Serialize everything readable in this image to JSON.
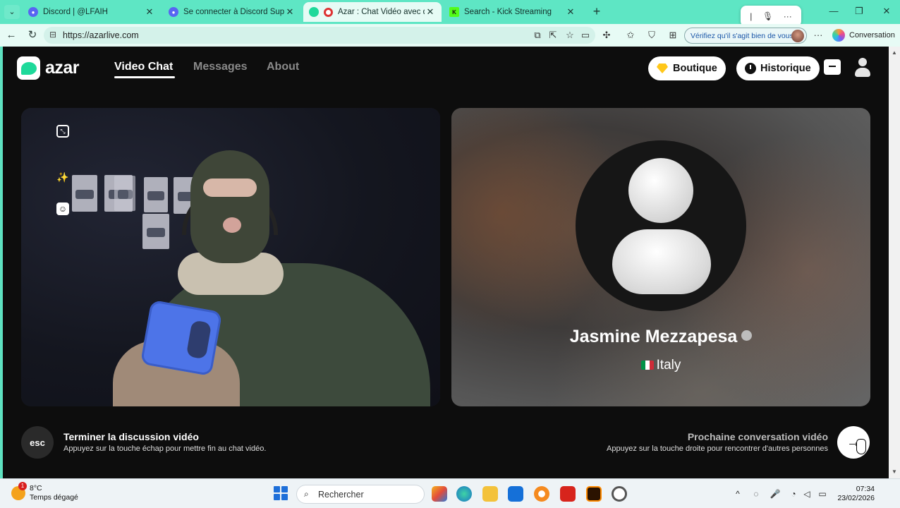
{
  "browser": {
    "tabs": [
      {
        "title": "Discord | @LFAIH",
        "icon": "discord-icon",
        "color": "#5865f2"
      },
      {
        "title": "Se connecter à Discord Support",
        "icon": "discord-icon",
        "color": "#5865f2"
      },
      {
        "title": "Azar : Chat Vidéo avec de nou",
        "icon": "azar-icon",
        "color": "#1ed99a"
      },
      {
        "title": "Search - Kick Streaming",
        "icon": "kick-icon",
        "color": "#53fc18"
      }
    ],
    "url": "https://azarlive.com",
    "verify_text": "Vérifiez qu'il s'agit bien de vous",
    "conversation_label": "Conversation"
  },
  "site": {
    "logo_text": "azar",
    "nav": [
      {
        "label": "Video Chat"
      },
      {
        "label": "Messages"
      },
      {
        "label": "About"
      }
    ],
    "boutique_label": "Boutique",
    "historique_label": "Historique"
  },
  "partner": {
    "name": "Jasmine Mezzapesa",
    "country": "Italy"
  },
  "controls": {
    "esc_label": "esc",
    "end_title": "Terminer la discussion vidéo",
    "end_subtitle": "Appuyez sur la touche échap pour mettre fin au chat vidéo.",
    "next_title": "Prochaine conversation vidéo",
    "next_subtitle": "Appuyez sur la touche droite pour rencontrer d'autres personnes"
  },
  "taskbar": {
    "weather_badge": "1",
    "temperature": "8°C",
    "weather_desc": "Temps dégagé",
    "search_placeholder": "Rechercher",
    "time": "07:34",
    "date": "23/02/2026"
  },
  "colors": {
    "browser_frame": "#5ee6c4",
    "brand": "#1ed99a",
    "page_bg": "#0d0d0d"
  }
}
